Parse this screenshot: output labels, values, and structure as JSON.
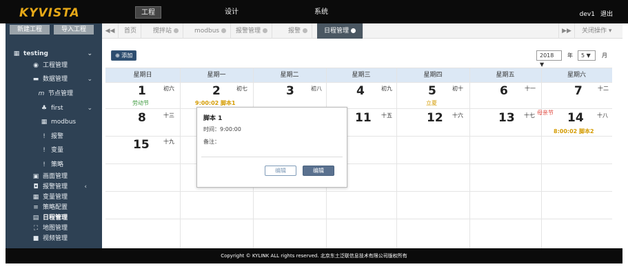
{
  "brand": "KYVISTA",
  "topnav": {
    "items": [
      "工程",
      "设计",
      "系统"
    ],
    "active": "工程"
  },
  "user": {
    "name": "dev1",
    "logout": "退出"
  },
  "sidebar": {
    "new_project": "新建工程",
    "import_project": "导入工程",
    "project": "testing",
    "items": {
      "project_mgmt": "工程管理",
      "data_mgmt": "数据管理",
      "node_mgmt": "节点管理",
      "first": "first",
      "modbus": "modbus",
      "alarm": "报警",
      "variable": "变量",
      "strategy": "策略",
      "screen_mgmt": "画面管理",
      "alarm_mgmt": "报警管理",
      "variable_mgmt": "变量管理",
      "strategy_config": "策略配置",
      "schedule_mgmt": "日程管理",
      "map_mgmt": "地图管理",
      "video_mgmt": "视频管理"
    }
  },
  "tabs": [
    "首页",
    "搅拌站",
    "modbus",
    "报警管理",
    "报警",
    "日程管理"
  ],
  "active_tab": "日程管理",
  "close_ops": "关闭操作",
  "toolbar": {
    "add": "添加",
    "year": "2018",
    "year_unit": "年",
    "month": "5",
    "month_unit": "月"
  },
  "weekdays": [
    "星期日",
    "星期一",
    "星期二",
    "星期三",
    "星期四",
    "星期五",
    "星期六"
  ],
  "week1": [
    {
      "day": "1",
      "lunar": "初六",
      "festival": "劳动节",
      "event": ""
    },
    {
      "day": "2",
      "lunar": "初七",
      "festival": "",
      "event": "9:00:02 脚本1"
    },
    {
      "day": "3",
      "lunar": "初八",
      "festival": "",
      "event": ""
    },
    {
      "day": "4",
      "lunar": "初九",
      "festival": "",
      "event": ""
    },
    {
      "day": "5",
      "lunar": "初十",
      "festival": "立夏",
      "event": ""
    },
    {
      "day": "6",
      "lunar": "十一",
      "festival": "",
      "event": ""
    },
    {
      "day": "7",
      "lunar": "十二",
      "festival": "",
      "event": ""
    }
  ],
  "week2": [
    {
      "day": "8",
      "lunar": "十三"
    },
    {
      "day": "11",
      "lunar": "十五"
    },
    {
      "day": "12",
      "lunar": "十六"
    },
    {
      "day": "13",
      "lunar": "十七"
    },
    {
      "day": "14",
      "lunar": "十八",
      "festival": "母亲节",
      "event": "8:00:02 脚本2"
    }
  ],
  "week3": [
    {
      "day": "15",
      "lunar": "十九"
    }
  ],
  "popup": {
    "title": "脚本 1",
    "time": "时间：9:00:00",
    "note": "备注：",
    "btn1": "编辑",
    "btn2": "编辑"
  },
  "footer": "Copyright © KYLINK ALL rights reserved. 北京东土泛联信息技术有限公司版权所有",
  "colors": {
    "accent": "#2d4d6f",
    "sidebar": "#2e4154",
    "header": "#dce8f5",
    "event": "#d49b00",
    "festival_green": "#3c9a3c",
    "festival_red": "#e0483f"
  }
}
